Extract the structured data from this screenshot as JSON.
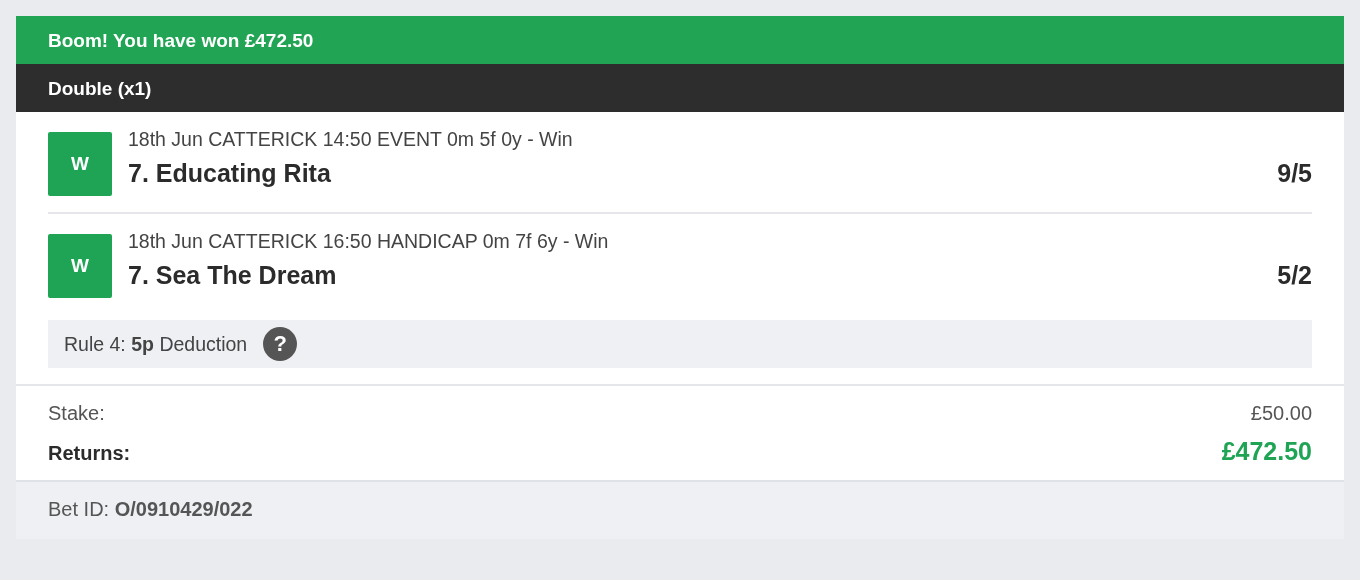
{
  "banner": {
    "title": "Boom! You have won £472.50"
  },
  "bet_header": {
    "title": "Double (x1)"
  },
  "legs": [
    {
      "result": "W",
      "event": "18th Jun CATTERICK 14:50 EVENT 0m 5f 0y - Win",
      "selection": "7. Educating Rita",
      "odds": "9/5"
    },
    {
      "result": "W",
      "event": "18th Jun CATTERICK 16:50 HANDICAP 0m 7f 6y - Win",
      "selection": "7. Sea The Dream",
      "odds": "5/2"
    }
  ],
  "rule4": {
    "text": "Rule 4: **5p** Deduction",
    "help_icon": "?"
  },
  "totals": [
    {
      "kind": "stake",
      "label": "Stake:",
      "value": "£50.00"
    },
    {
      "kind": "returns",
      "label": "Returns:",
      "value": "£472.50"
    }
  ],
  "footer": {
    "bet_id": "Bet ID: **O/0910429/022**"
  }
}
